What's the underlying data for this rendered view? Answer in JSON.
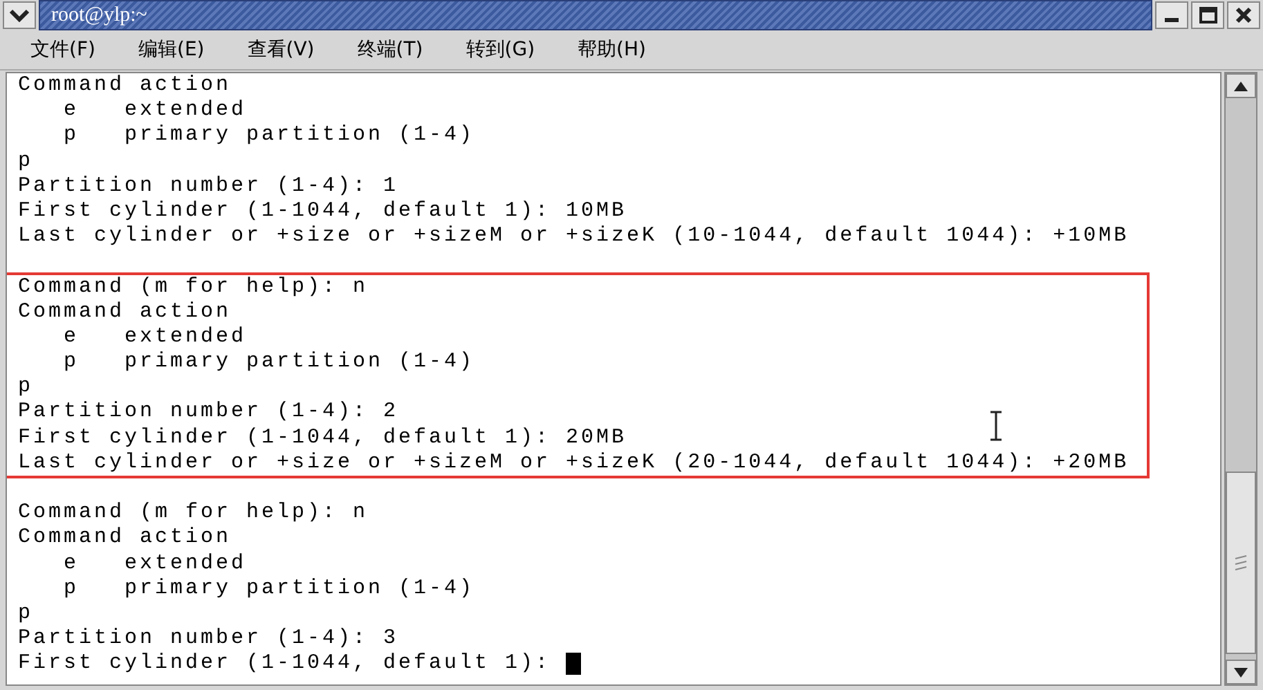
{
  "window": {
    "title": "root@ylp:~"
  },
  "menu": [
    "文件(F)",
    "编辑(E)",
    "查看(V)",
    "终端(T)",
    "转到(G)",
    "帮助(H)"
  ],
  "terminal": {
    "cursor": true,
    "blocks": [
      {
        "highlighted": false,
        "lines": [
          "Command action",
          "   e   extended",
          "   p   primary partition (1-4)",
          "p",
          "Partition number (1-4): 1",
          "First cylinder (1-1044, default 1): 10MB",
          "Last cylinder or +size or +sizeM or +sizeK (10-1044, default 1044): +10MB"
        ]
      },
      {
        "highlighted": true,
        "lines": [
          "Command (m for help): n",
          "Command action",
          "   e   extended",
          "   p   primary partition (1-4)",
          "p",
          "Partition number (1-4): 2",
          "First cylinder (1-1044, default 1): 20MB",
          "Last cylinder or +size or +sizeM or +sizeK (20-1044, default 1044): +20MB"
        ]
      },
      {
        "highlighted": false,
        "lines": [
          "Command (m for help): n",
          "Command action",
          "   e   extended",
          "   p   primary partition (1-4)",
          "p",
          "Partition number (1-4): 3",
          "First cylinder (1-1044, default 1): "
        ]
      }
    ]
  }
}
